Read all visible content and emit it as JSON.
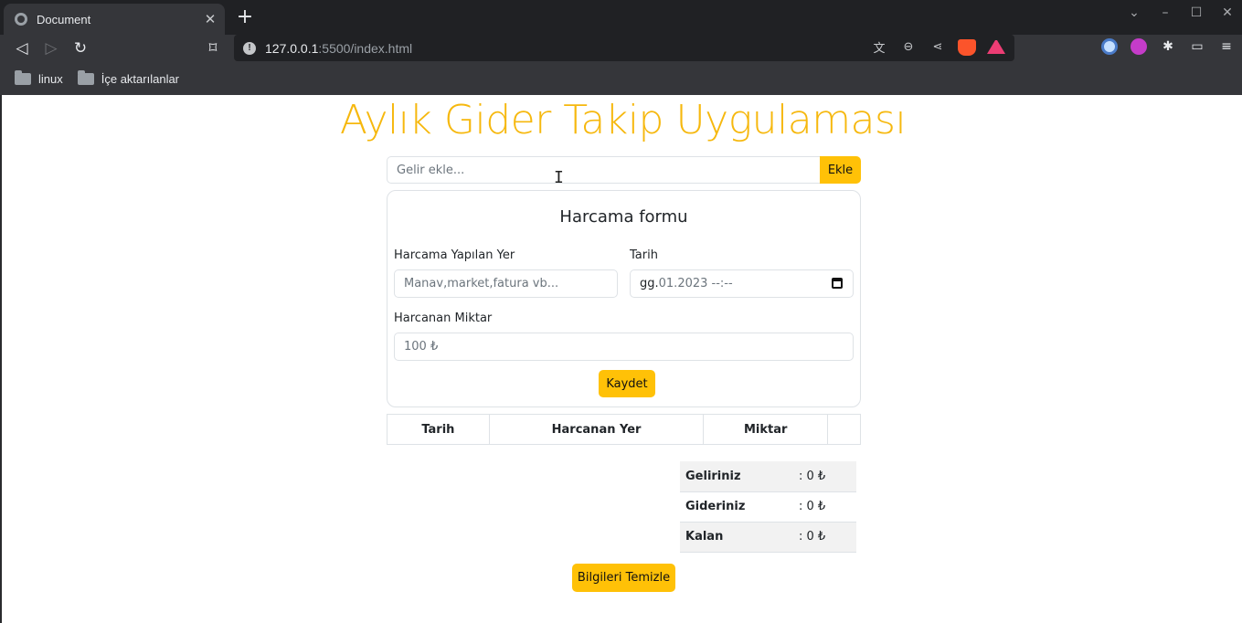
{
  "browser": {
    "tab_title": "Document",
    "tab_close": "✕",
    "new_tab": "+",
    "url_host": "127.0.0.1",
    "url_path": ":5500/index.html",
    "bookmarks": [
      "linux",
      "İçe aktarılanlar"
    ]
  },
  "page": {
    "title": "Aylık Gider Takip Uygulaması",
    "income_placeholder": "Gelir ekle...",
    "add_button": "Ekle"
  },
  "form": {
    "title": "Harcama formu",
    "place_label": "Harcama Yapılan Yer",
    "place_placeholder": "Manav,market,fatura vb...",
    "date_label": "Tarih",
    "date_prefix": "gg.",
    "date_value": "01.2023 --:--",
    "amount_label": "Harcanan Miktar",
    "amount_placeholder": "100 ₺",
    "save_button": "Kaydet"
  },
  "expense_table": {
    "headers": [
      "Tarih",
      "Harcanan Yer",
      "Miktar",
      ""
    ]
  },
  "summary": {
    "rows": [
      {
        "label": "Geliriniz",
        "value": ": 0 ₺"
      },
      {
        "label": "Gideriniz",
        "value": ": 0 ₺"
      },
      {
        "label": "Kalan",
        "value": ": 0 ₺"
      }
    ]
  },
  "clear_button": "Bilgileri Temizle",
  "colors": {
    "accent": "#ffc107",
    "title": "#f6b80e"
  }
}
